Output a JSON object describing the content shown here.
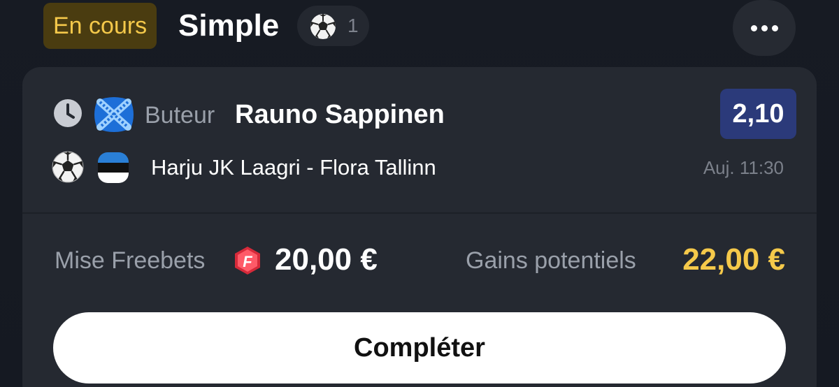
{
  "header": {
    "status_badge": "En cours",
    "bet_type": "Simple",
    "sport_icon": "football-icon",
    "selection_count": "1",
    "more_icon": "more-horizontal-icon"
  },
  "selection": {
    "status_icon": "clock-icon",
    "team_icon": "team-crest-icon",
    "market": "Buteur",
    "name": "Rauno Sappinen",
    "odds": "2,10",
    "sport_icon": "football-icon",
    "country_icon": "estonia-flag-icon",
    "match": "Harju JK Laagri - Flora Tallinn",
    "time": "Auj. 11:30"
  },
  "summary": {
    "stake_label": "Mise Freebets",
    "freebet_icon": "freebet-icon",
    "stake_value": "20,00 €",
    "gains_label": "Gains potentiels",
    "gains_value": "22,00 €"
  },
  "actions": {
    "complete_label": "Compléter"
  },
  "colors": {
    "background": "#161a22",
    "card": "#252931",
    "accent_yellow": "#f5c94a",
    "odds_blue": "#2b3a7a",
    "badge_bg": "#4a3c10"
  }
}
